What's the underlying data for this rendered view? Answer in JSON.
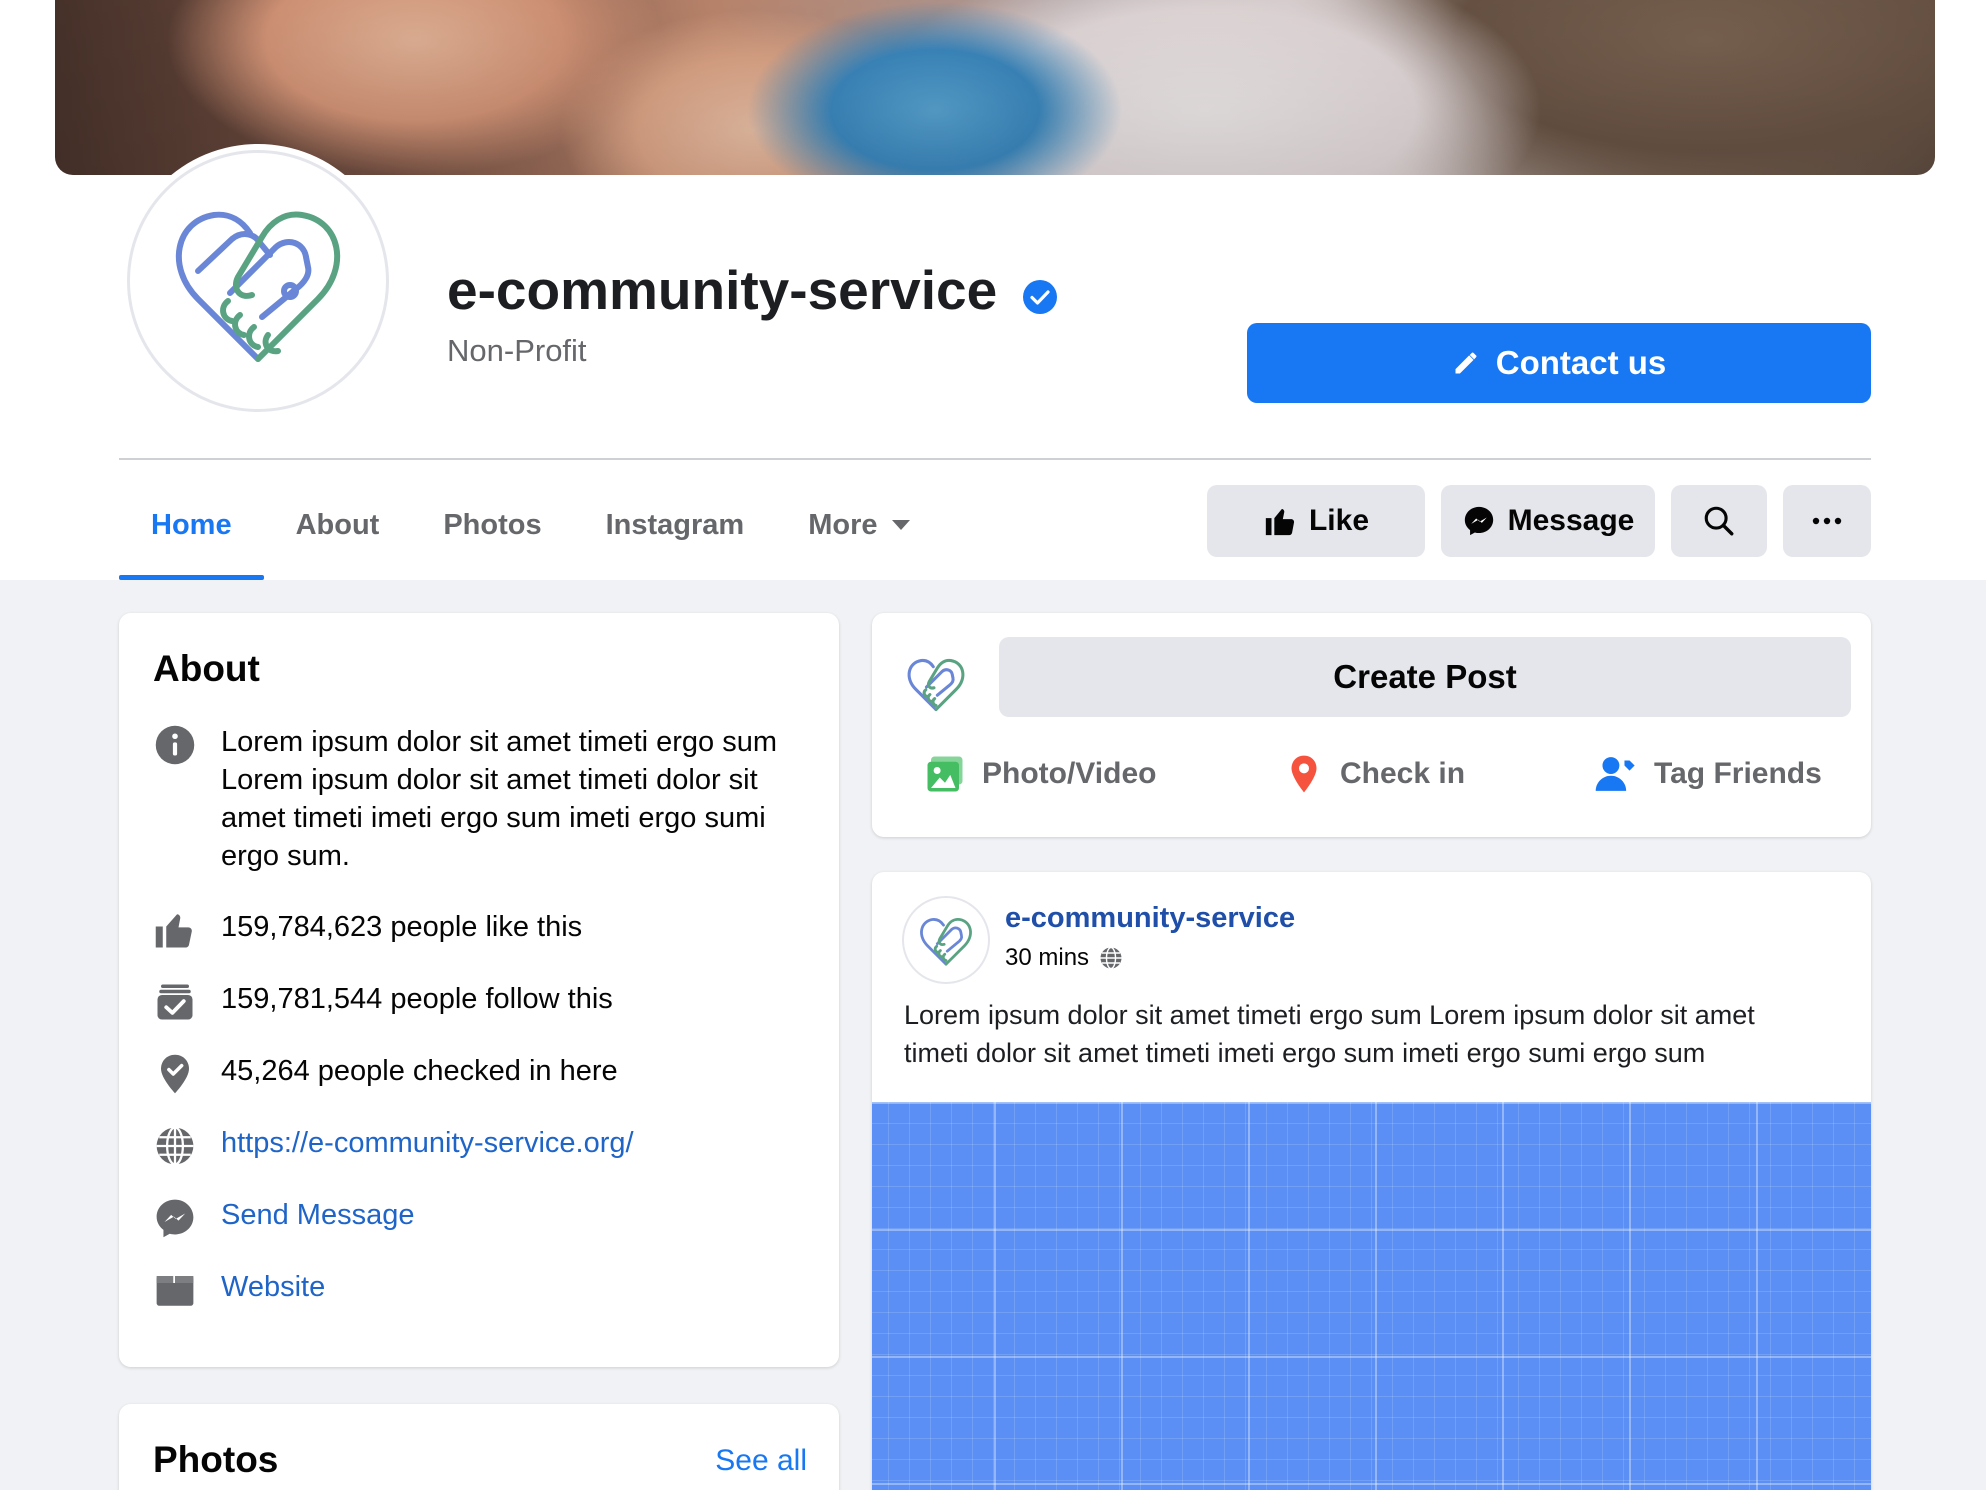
{
  "page": {
    "name": "e-community-service",
    "category": "Non-Profit",
    "verified": true
  },
  "colors": {
    "accent": "#1877f2",
    "link": "#1f65c8",
    "secondary_text": "#65676b",
    "button_gray": "#e4e6eb",
    "logo_blue": "#6a86d6",
    "logo_green": "#5aa382"
  },
  "header": {
    "contact_label": "Contact us",
    "contact_icon": "pencil-icon"
  },
  "tabs": [
    {
      "label": "Home",
      "active": true
    },
    {
      "label": "About",
      "active": false
    },
    {
      "label": "Photos",
      "active": false
    },
    {
      "label": "Instagram",
      "active": false
    },
    {
      "label": "More",
      "active": false
    }
  ],
  "actions": {
    "like_label": "Like",
    "message_label": "Message",
    "search_icon": "search-icon",
    "more_icon": "ellipsis-icon"
  },
  "about": {
    "title": "About",
    "description": "Lorem ipsum dolor sit amet timeti ergo sum Lorem ipsum dolor sit amet timeti dolor sit amet timeti imeti ergo sum imeti ergo sumi ergo sum.",
    "likes": "159,784,623 people like this",
    "follows": "159,781,544 people follow this",
    "checkins": "45,264 people checked in here",
    "url": "https://e-community-service.org/",
    "send_message": "Send Message",
    "website": "Website"
  },
  "photos": {
    "title": "Photos",
    "see_all": "See all"
  },
  "composer": {
    "create_post": "Create Post",
    "photo_video": "Photo/Video",
    "check_in": "Check in",
    "tag_friends": "Tag Friends"
  },
  "post": {
    "author": "e-community-service",
    "time": "30 mins",
    "text": "Lorem ipsum dolor sit amet timeti ergo sum Lorem ipsum dolor sit amet timeti dolor sit amet timeti imeti ergo sum imeti ergo sumi ergo sum"
  }
}
